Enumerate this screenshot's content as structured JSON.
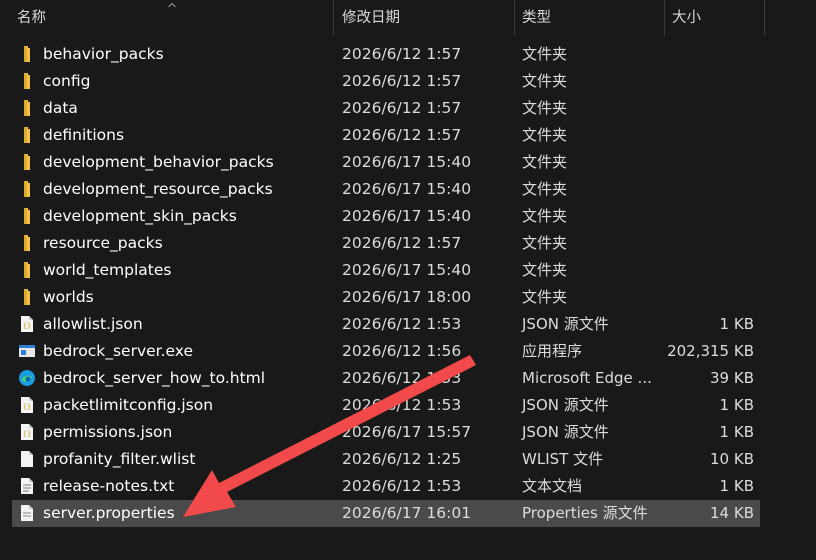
{
  "columns": {
    "name": "名称",
    "date": "修改日期",
    "type": "类型",
    "size": "大小"
  },
  "files": [
    {
      "name": "behavior_packs",
      "date": "2026/6/12 1:57",
      "type": "文件夹",
      "size": "",
      "icon": "folder-icon"
    },
    {
      "name": "config",
      "date": "2026/6/12 1:57",
      "type": "文件夹",
      "size": "",
      "icon": "folder-icon"
    },
    {
      "name": "data",
      "date": "2026/6/12 1:57",
      "type": "文件夹",
      "size": "",
      "icon": "folder-icon"
    },
    {
      "name": "definitions",
      "date": "2026/6/12 1:57",
      "type": "文件夹",
      "size": "",
      "icon": "folder-icon"
    },
    {
      "name": "development_behavior_packs",
      "date": "2026/6/17 15:40",
      "type": "文件夹",
      "size": "",
      "icon": "folder-icon"
    },
    {
      "name": "development_resource_packs",
      "date": "2026/6/17 15:40",
      "type": "文件夹",
      "size": "",
      "icon": "folder-icon"
    },
    {
      "name": "development_skin_packs",
      "date": "2026/6/17 15:40",
      "type": "文件夹",
      "size": "",
      "icon": "folder-icon"
    },
    {
      "name": "resource_packs",
      "date": "2026/6/12 1:57",
      "type": "文件夹",
      "size": "",
      "icon": "folder-icon"
    },
    {
      "name": "world_templates",
      "date": "2026/6/17 15:40",
      "type": "文件夹",
      "size": "",
      "icon": "folder-icon"
    },
    {
      "name": "worlds",
      "date": "2026/6/17 18:00",
      "type": "文件夹",
      "size": "",
      "icon": "folder-icon"
    },
    {
      "name": "allowlist.json",
      "date": "2026/6/12 1:53",
      "type": "JSON 源文件",
      "size": "1 KB",
      "icon": "json-file-icon"
    },
    {
      "name": "bedrock_server.exe",
      "date": "2026/6/12 1:56",
      "type": "应用程序",
      "size": "202,315 KB",
      "icon": "exe-file-icon"
    },
    {
      "name": "bedrock_server_how_to.html",
      "date": "2026/6/12 1:53",
      "type": "Microsoft Edge ...",
      "size": "39 KB",
      "icon": "edge-icon"
    },
    {
      "name": "packetlimitconfig.json",
      "date": "2026/6/12 1:53",
      "type": "JSON 源文件",
      "size": "1 KB",
      "icon": "json-file-icon"
    },
    {
      "name": "permissions.json",
      "date": "2026/6/17 15:57",
      "type": "JSON 源文件",
      "size": "1 KB",
      "icon": "json-file-icon"
    },
    {
      "name": "profanity_filter.wlist",
      "date": "2026/6/12 1:25",
      "type": "WLIST 文件",
      "size": "10 KB",
      "icon": "generic-file-icon"
    },
    {
      "name": "release-notes.txt",
      "date": "2026/6/12 1:53",
      "type": "文本文档",
      "size": "1 KB",
      "icon": "text-file-icon"
    },
    {
      "name": "server.properties",
      "date": "2026/6/17 16:01",
      "type": "Properties 源文件",
      "size": "14 KB",
      "icon": "properties-file-icon",
      "selected": true
    }
  ],
  "colors": {
    "background": "#191919",
    "selected_row": "#4a4a4a",
    "folder": "#f2c14e",
    "annotation_arrow": "#f24a4a"
  }
}
